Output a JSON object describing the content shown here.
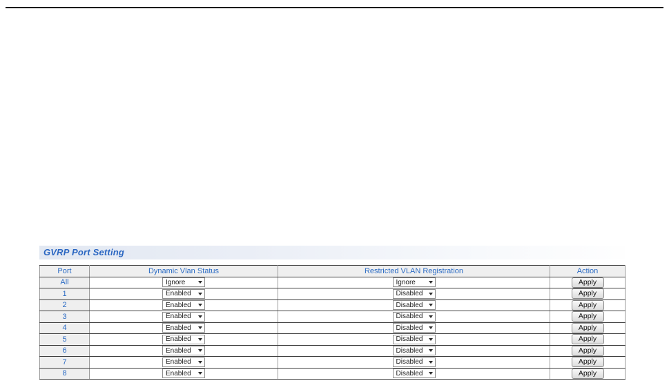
{
  "title_bar": {
    "title": "GVRP Port Setting"
  },
  "colors": {
    "accent_blue": "#2b6bc4",
    "header_bg": "#efefef",
    "titlebar_gradient_start": "#e2e8f2",
    "titlebar_gradient_end": "#fefefe"
  },
  "table": {
    "columns": [
      "Port",
      "Dynamic Vlan Status",
      "Restricted VLAN Registration",
      "Action"
    ],
    "apply_label": "Apply",
    "rows": [
      {
        "port": "All",
        "dynamic_vlan_status": "Ignore",
        "restricted_vlan_registration": "Ignore",
        "action": "Apply"
      },
      {
        "port": "1",
        "dynamic_vlan_status": "Enabled",
        "restricted_vlan_registration": "Disabled",
        "action": "Apply"
      },
      {
        "port": "2",
        "dynamic_vlan_status": "Enabled",
        "restricted_vlan_registration": "Disabled",
        "action": "Apply"
      },
      {
        "port": "3",
        "dynamic_vlan_status": "Enabled",
        "restricted_vlan_registration": "Disabled",
        "action": "Apply"
      },
      {
        "port": "4",
        "dynamic_vlan_status": "Enabled",
        "restricted_vlan_registration": "Disabled",
        "action": "Apply"
      },
      {
        "port": "5",
        "dynamic_vlan_status": "Enabled",
        "restricted_vlan_registration": "Disabled",
        "action": "Apply"
      },
      {
        "port": "6",
        "dynamic_vlan_status": "Enabled",
        "restricted_vlan_registration": "Disabled",
        "action": "Apply"
      },
      {
        "port": "7",
        "dynamic_vlan_status": "Enabled",
        "restricted_vlan_registration": "Disabled",
        "action": "Apply"
      },
      {
        "port": "8",
        "dynamic_vlan_status": "Enabled",
        "restricted_vlan_registration": "Disabled",
        "action": "Apply"
      }
    ]
  }
}
